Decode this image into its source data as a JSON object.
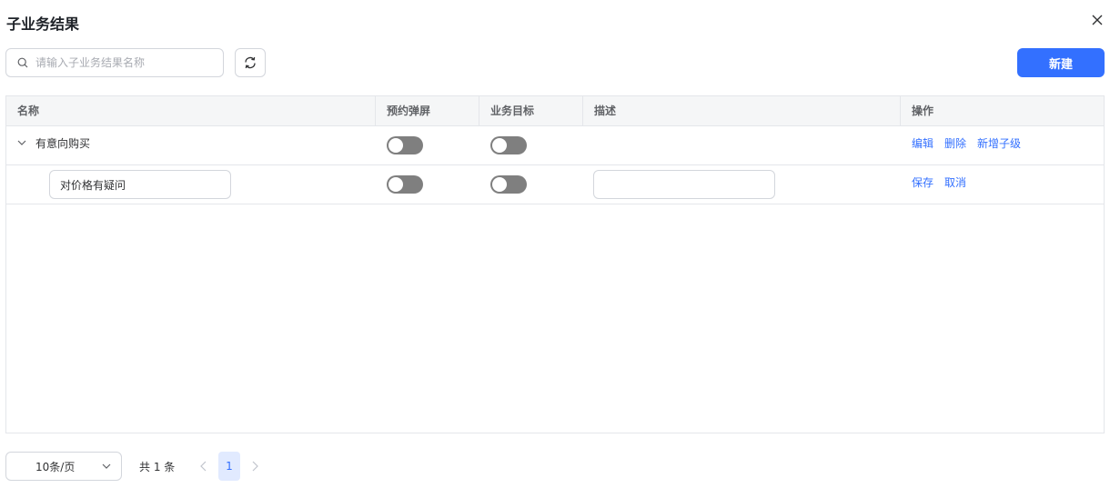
{
  "dialog": {
    "title": "子业务结果"
  },
  "toolbar": {
    "search_placeholder": "请输入子业务结果名称",
    "search_value": "",
    "new_button": "新建"
  },
  "table": {
    "columns": [
      "名称",
      "预约弹屏",
      "业务目标",
      "描述",
      "操作"
    ],
    "rows": [
      {
        "name": "有意向购买",
        "expanded": true,
        "appointment_popup": false,
        "business_goal": false,
        "description": "",
        "actions": [
          "编辑",
          "删除",
          "新增子级"
        ]
      },
      {
        "name_input_value": "对价格有疑问",
        "appointment_popup": false,
        "business_goal": false,
        "description_input_value": "",
        "actions": [
          "保存",
          "取消"
        ]
      }
    ]
  },
  "pagination": {
    "page_size": "10条/页",
    "total": "共 1 条",
    "current_page": "1"
  },
  "colors": {
    "primary": "#3370ff",
    "toggle_off": "#7f7f7f",
    "header_bg": "#f5f6f7",
    "active_page_bg": "#e1eaff"
  },
  "icons": [
    "close-icon",
    "search-icon",
    "refresh-icon",
    "chevron-down-icon",
    "chevron-left-icon",
    "chevron-right-icon"
  ]
}
